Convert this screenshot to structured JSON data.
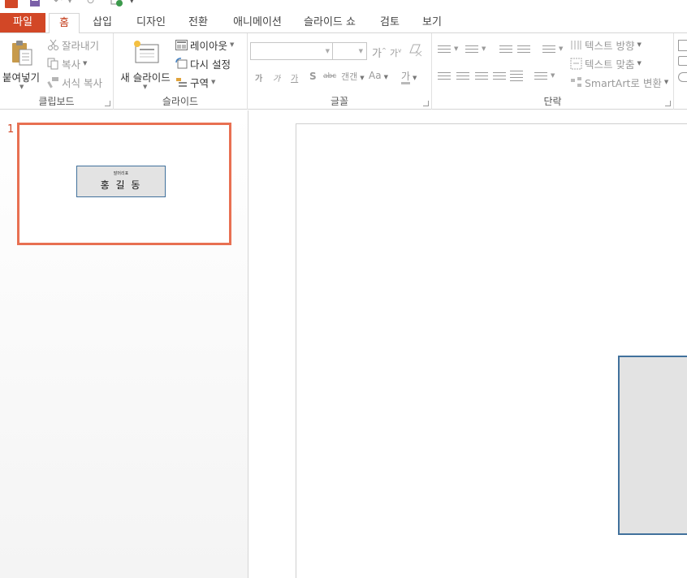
{
  "colors": {
    "accent": "#d24726",
    "active_tab_text": "#c43e1c",
    "thumbnail_border": "#e87052",
    "shape_fill": "#e3e3e3",
    "shape_border": "#41719c"
  },
  "quick_access": {
    "icons": [
      "powerpoint-logo-icon",
      "save-icon",
      "undo-icon",
      "redo-icon",
      "start-from-beginning-icon",
      "customize-dropdown-icon"
    ]
  },
  "tabs": [
    {
      "label": "파일",
      "active": false
    },
    {
      "label": "홈",
      "active": true
    },
    {
      "label": "삽입",
      "active": false
    },
    {
      "label": "디자인",
      "active": false
    },
    {
      "label": "전환",
      "active": false
    },
    {
      "label": "애니메이션",
      "active": false
    },
    {
      "label": "슬라이드 쇼",
      "active": false
    },
    {
      "label": "검토",
      "active": false
    },
    {
      "label": "보기",
      "active": false
    }
  ],
  "ribbon": {
    "clipboard": {
      "label": "클립보드",
      "paste": "붙여넣기",
      "cut": "잘라내기",
      "copy": "복사",
      "format_painter": "서식 복사"
    },
    "slides": {
      "label": "슬라이드",
      "new_slide": "새 슬라이드",
      "layout": "레이아웃",
      "reset": "다시 설정",
      "section": "구역"
    },
    "font": {
      "label": "글꼴",
      "font_name": "",
      "font_size": "",
      "grow": "가",
      "shrink": "가",
      "bold": "가",
      "italic": "가",
      "underline": "가",
      "shadow": "S",
      "strike": "abc",
      "spacing": "갠갠",
      "case": "Aa",
      "color": "가"
    },
    "paragraph": {
      "label": "단락",
      "text_direction": "텍스트 방향",
      "align_text": "텍스트 맞춤",
      "smartart": "SmartArt로 변환"
    }
  },
  "slide_panel": {
    "slide_number": "1",
    "thumbnail_small_text": "말머리표",
    "thumbnail_name": "홍 길 동"
  }
}
